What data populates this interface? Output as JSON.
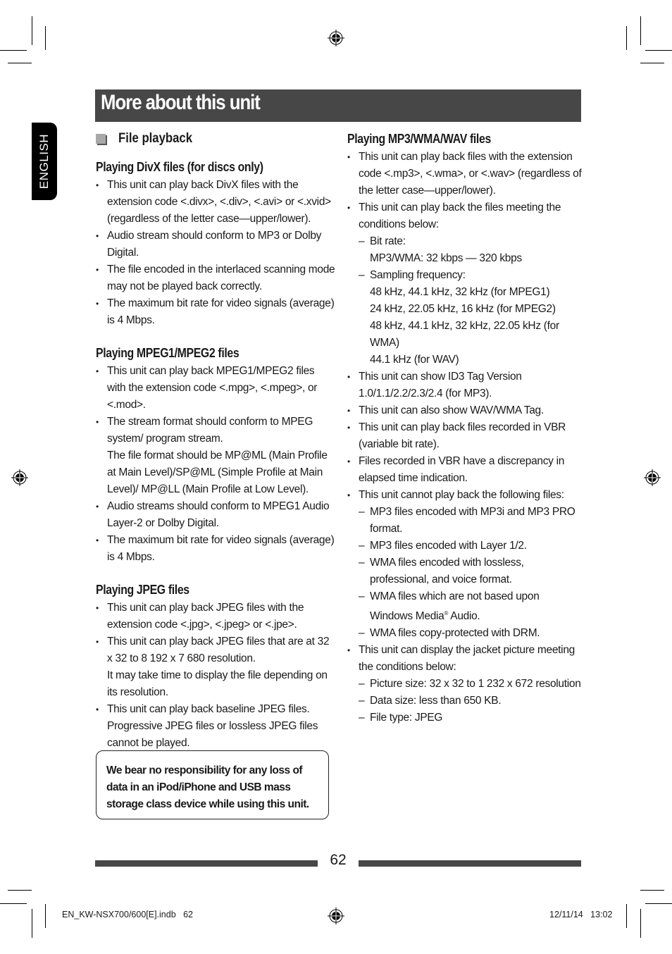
{
  "page": {
    "title": "More about this unit",
    "language_tab": "ENGLISH",
    "page_number": "62"
  },
  "left_column": {
    "section_title": "File playback",
    "divx": {
      "heading": "Playing DivX files (for discs only)",
      "items": [
        "This unit can play back DivX files with the extension code <.divx>, <.div>, <.avi> or <.xvid> (regardless of the letter case—upper/lower).",
        "Audio stream should conform to MP3 or Dolby Digital.",
        "The file encoded in the interlaced scanning mode may not be played back correctly.",
        "The maximum bit rate for video signals (average) is 4 Mbps."
      ]
    },
    "mpeg": {
      "heading": "Playing MPEG1/MPEG2 files",
      "items": [
        "This unit can play back MPEG1/MPEG2 files with the extension code <.mpg>, <.mpeg>, or <.mod>.",
        "The stream format should conform to MPEG system/ program stream.",
        "Audio streams should conform to MPEG1 Audio Layer-2 or Dolby Digital.",
        "The maximum bit rate for video signals (average) is 4 Mbps."
      ],
      "item2_note": "The file format should be MP@ML (Main Profile at Main Level)/SP@ML (Simple Profile at Main Level)/ MP@LL (Main Profile at Low Level)."
    },
    "jpeg": {
      "heading": "Playing JPEG files",
      "items": [
        "This unit can play back JPEG files with the extension code <.jpg>, <.jpeg> or <.jpe>.",
        "This unit can play back JPEG files that are at 32 x 32 to 8 192 x 7 680 resolution.",
        "This unit can play back baseline JPEG files."
      ],
      "item2_note": "It may take time to display the file depending on its resolution.",
      "item3_note": "Progressive JPEG files or lossless JPEG files cannot be played."
    },
    "notice": "We bear no responsibility for any loss of data in an iPod/iPhone and USB mass storage class device while using this unit."
  },
  "right_column": {
    "heading": "Playing MP3/WMA/WAV files",
    "item1": "This unit can play back files with the extension code <.mp3>, <.wma>, or <.wav> (regardless of the letter case—upper/lower).",
    "item2": "This unit can play back the files meeting the conditions below:",
    "bit_rate_label": "Bit rate:",
    "bit_rate_value": "MP3/WMA: 32 kbps — 320 kbps",
    "sampling_label": "Sampling frequency:",
    "sampling_values": [
      "48 kHz, 44.1 kHz, 32 kHz (for MPEG1)",
      "24 kHz, 22.05 kHz, 16 kHz (for MPEG2)",
      "48 kHz, 44.1 kHz, 32 kHz, 22.05 kHz (for WMA)",
      "44.1 kHz (for WAV)"
    ],
    "item3": "This unit can show ID3 Tag Version 1.0/1.1/2.2/2.3/2.4 (for MP3).",
    "item4": "This unit can also show WAV/WMA Tag.",
    "item5": "This unit can play back files recorded in VBR (variable bit rate).",
    "item6": "Files recorded in VBR have a discrepancy in elapsed time indication.",
    "item7": "This unit cannot play back the following files:",
    "cannot_play": [
      "MP3 files encoded with MP3i and MP3 PRO format.",
      "MP3 files encoded with Layer 1/2.",
      "WMA files encoded with lossless, professional, and voice format.",
      "WMA files which are not based upon Windows Media",
      "WMA files copy-protected with DRM."
    ],
    "cannot_play_4_suffix": " Audio.",
    "registered_mark": "®",
    "item8": "This unit can display the jacket picture meeting the conditions below:",
    "jacket_conditions": [
      "Picture size: 32 x 32 to 1 232 x 672 resolution",
      "Data size: less than 650 KB.",
      "File type: JPEG"
    ]
  },
  "footer": {
    "file_name": "EN_KW-NSX700/600[E].indb   62",
    "date_time": "12/11/14   13:02"
  },
  "colors": {
    "title_bar": "#474747",
    "section_square": "#a8a8a8",
    "lang_tab": "#000000"
  }
}
